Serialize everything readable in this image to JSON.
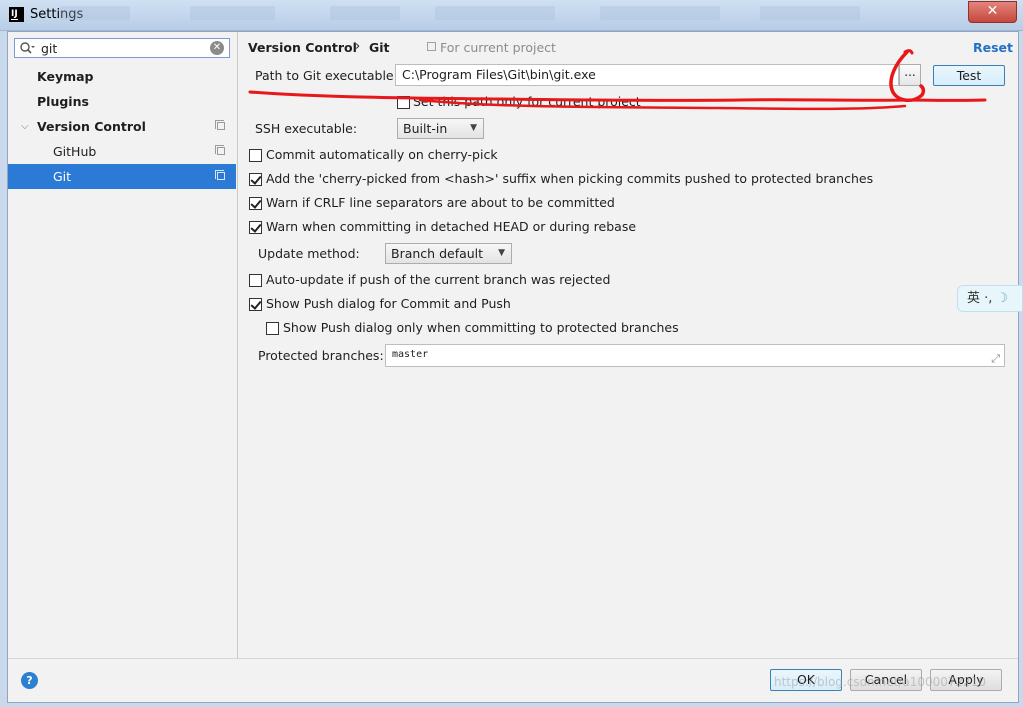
{
  "window": {
    "title": "Settings",
    "close_glyph": "✕"
  },
  "sidebar": {
    "search_value": "git",
    "items": [
      {
        "label": "Keymap"
      },
      {
        "label": "Plugins"
      },
      {
        "label": "Version Control"
      },
      {
        "label": "GitHub"
      },
      {
        "label": "Git"
      }
    ]
  },
  "header": {
    "breadcrumb_parent": "Version Control",
    "breadcrumb_separator": "›",
    "breadcrumb_current": "Git",
    "scope_text": "For current project",
    "reset_label": "Reset"
  },
  "git": {
    "path_label": "Path to Git executable:",
    "path_value": "C:\\Program Files\\Git\\bin\\git.exe",
    "browse_label": "...",
    "test_label": "Test",
    "set_path_only_label": "Set this path only for current project",
    "set_path_only_checked": false,
    "ssh_label": "SSH executable:",
    "ssh_value": "Built-in",
    "options": [
      {
        "label": "Commit automatically on cherry-pick",
        "checked": false
      },
      {
        "label": "Add the 'cherry-picked from <hash>' suffix when picking commits pushed to protected branches",
        "checked": true
      },
      {
        "label": "Warn if CRLF line separators are about to be committed",
        "checked": true
      },
      {
        "label": "Warn when committing in detached HEAD or during rebase",
        "checked": true
      }
    ],
    "update_method_label": "Update method:",
    "update_method_value": "Branch default",
    "auto_update_label": "Auto-update if push of the current branch was rejected",
    "auto_update_checked": false,
    "show_push_label": "Show Push dialog for Commit and Push",
    "show_push_checked": true,
    "show_push_protected_label": "Show Push dialog only when committing to protected branches",
    "show_push_protected_checked": false,
    "protected_label": "Protected branches:",
    "protected_value": "master"
  },
  "footer": {
    "help_glyph": "?",
    "ok_label": "OK",
    "cancel_label": "Cancel",
    "apply_label": "Apply",
    "watermark": "https://blog.csdn.net/a1000072210"
  },
  "ime": {
    "text": "英 ·,"
  },
  "colors": {
    "selection": "#2b7bd6",
    "link": "#2470c7",
    "annotation": "#e8181a"
  }
}
